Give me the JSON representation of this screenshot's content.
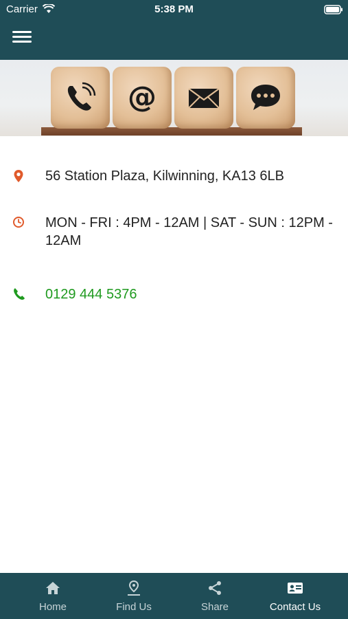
{
  "status_bar": {
    "carrier": "Carrier",
    "time": "5:38 PM"
  },
  "header": {
    "menu_icon": "hamburger-menu-icon"
  },
  "hero": {
    "icons": [
      "phone-icon",
      "at-sign-icon",
      "envelope-icon",
      "chat-bubble-icon"
    ]
  },
  "contact": {
    "address": "56 Station Plaza, Kilwinning, KA13 6LB",
    "hours": "MON - FRI : 4PM - 12AM | SAT - SUN : 12PM - 12AM",
    "phone": "0129 444 5376"
  },
  "colors": {
    "bar": "#1f4d57",
    "accent_orange": "#e05a2b",
    "phone_green": "#1f9a1f"
  },
  "tabs": [
    {
      "label": "Home",
      "icon": "home-icon"
    },
    {
      "label": "Find Us",
      "icon": "map-pin-icon"
    },
    {
      "label": "Share",
      "icon": "share-icon"
    },
    {
      "label": "Contact Us",
      "icon": "contact-card-icon",
      "active": true
    }
  ]
}
